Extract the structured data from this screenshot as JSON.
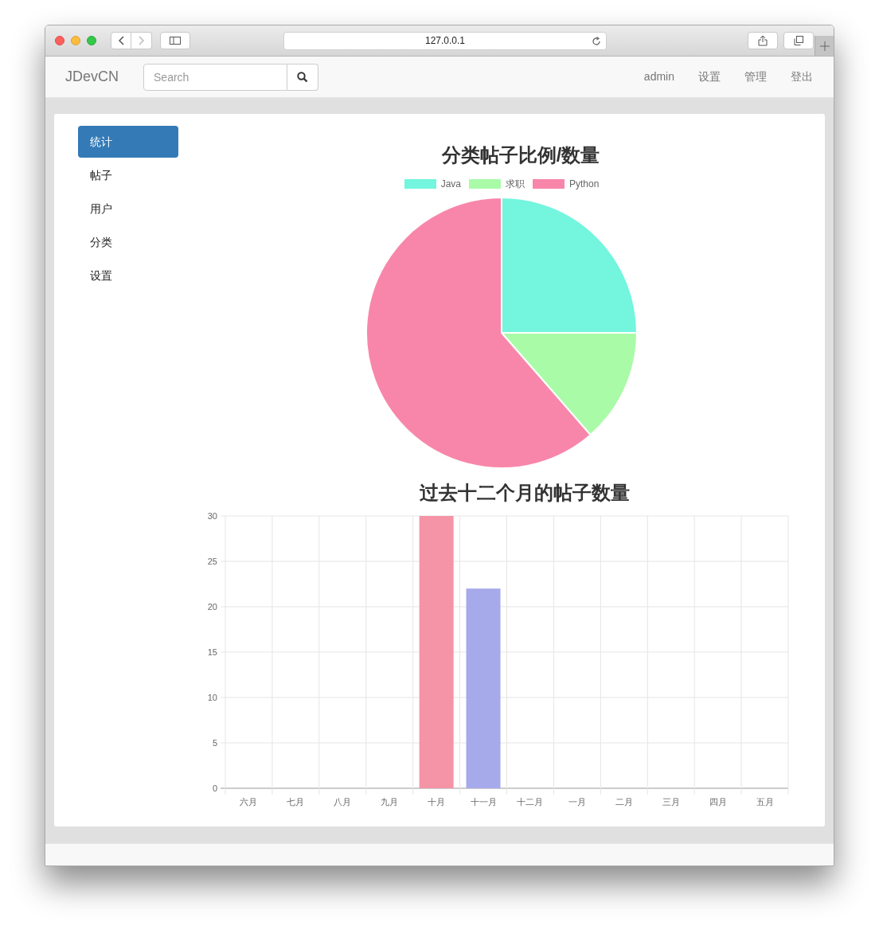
{
  "browser": {
    "url": "127.0.0.1"
  },
  "navbar": {
    "brand": "JDevCN",
    "search": {
      "placeholder": "Search"
    },
    "links": [
      "admin",
      "设置",
      "管理",
      "登出"
    ]
  },
  "sidebar": {
    "items": [
      {
        "label": "统计",
        "selected": true
      },
      {
        "label": "帖子",
        "selected": false
      },
      {
        "label": "用户",
        "selected": false
      },
      {
        "label": "分类",
        "selected": false
      },
      {
        "label": "设置",
        "selected": false
      }
    ]
  },
  "pie_chart": {
    "chart_data": {
      "type": "pie",
      "title": "分类帖子比例/数量",
      "categories": [
        "Java",
        "求职",
        "Python"
      ],
      "values": [
        25,
        13.6,
        61.4
      ],
      "colors": [
        "#73f5de",
        "#aafba8",
        "#f886aa"
      ],
      "legend": true
    }
  },
  "bar_chart": {
    "chart_data": {
      "type": "bar",
      "title": "过去十二个月的帖子数量",
      "categories": [
        "六月",
        "七月",
        "八月",
        "九月",
        "十月",
        "十一月",
        "十二月",
        "一月",
        "二月",
        "三月",
        "四月",
        "五月"
      ],
      "series": [
        {
          "color": "#f593a7",
          "values": [
            0,
            0,
            0,
            0,
            30,
            null,
            0,
            0,
            0,
            0,
            0,
            0
          ]
        },
        {
          "color": "#a6aaeb",
          "values": [
            null,
            null,
            null,
            null,
            null,
            22,
            null,
            null,
            null,
            null,
            null,
            null
          ]
        }
      ],
      "stacked": true,
      "grid": true,
      "ylim": [
        0,
        30
      ],
      "yticks": [
        0,
        5,
        10,
        15,
        20,
        25,
        30
      ]
    }
  }
}
